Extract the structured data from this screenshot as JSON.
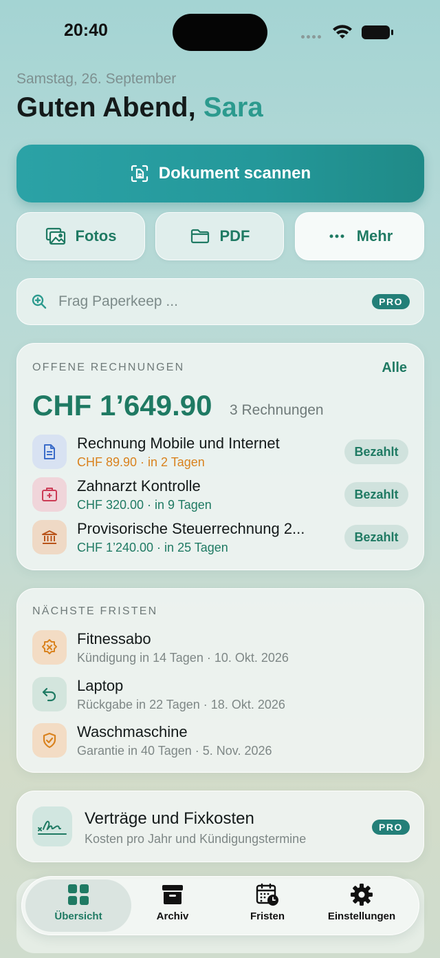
{
  "status": {
    "time": "20:40"
  },
  "header": {
    "date": "Samstag, 26. September",
    "greeting": "Guten Abend,",
    "name": "Sara"
  },
  "actions": {
    "scan_label": "Dokument scannen",
    "photos_label": "Fotos",
    "pdf_label": "PDF",
    "more_label": "Mehr"
  },
  "search": {
    "placeholder": "Frag Paperkeep ...",
    "badge": "PRO"
  },
  "invoices": {
    "title": "OFFENE RECHNUNGEN",
    "all_label": "Alle",
    "total": "CHF 1’649.90",
    "count": "3 Rechnungen",
    "items": [
      {
        "title": "Rechnung Mobile und Internet",
        "sub": "CHF 89.90 · in 2 Tagen",
        "action": "Bezahlt",
        "icon": "document-icon",
        "accent": "#d9821e"
      },
      {
        "title": "Zahnarzt Kontrolle",
        "sub": "CHF 320.00 · in 9 Tagen",
        "action": "Bezahlt",
        "icon": "medical-kit-icon",
        "accent": "#1f7a63"
      },
      {
        "title": "Provisorische Steuerrechnung 2...",
        "sub": "CHF 1’240.00 · in 25 Tagen",
        "action": "Bezahlt",
        "icon": "bank-icon",
        "accent": "#1f7a63"
      }
    ]
  },
  "deadlines": {
    "title": "NÄCHSTE FRISTEN",
    "items": [
      {
        "title": "Fitnessabo",
        "sub": "Kündigung in 14 Tagen · 10. Okt. 2026",
        "icon": "cancel-badge-icon"
      },
      {
        "title": "Laptop",
        "sub": "Rückgabe in 22 Tagen · 18. Okt. 2026",
        "icon": "return-arrow-icon"
      },
      {
        "title": "Waschmaschine",
        "sub": "Garantie in 40 Tagen · 5. Nov. 2026",
        "icon": "shield-check-icon"
      }
    ]
  },
  "contracts": {
    "title": "Verträge und Fixkosten",
    "sub": "Kosten pro Jahr und Kündigungstermine",
    "badge": "PRO"
  },
  "tabs": [
    {
      "label": "Übersicht",
      "icon": "grid-icon",
      "active": true
    },
    {
      "label": "Archiv",
      "icon": "archive-box-icon",
      "active": false
    },
    {
      "label": "Fristen",
      "icon": "calendar-clock-icon",
      "active": false
    },
    {
      "label": "Einstellungen",
      "icon": "gear-icon",
      "active": false
    }
  ],
  "colors": {
    "accent": "#1f7a63",
    "scan_button": "#24989a",
    "warning": "#d9821e"
  }
}
